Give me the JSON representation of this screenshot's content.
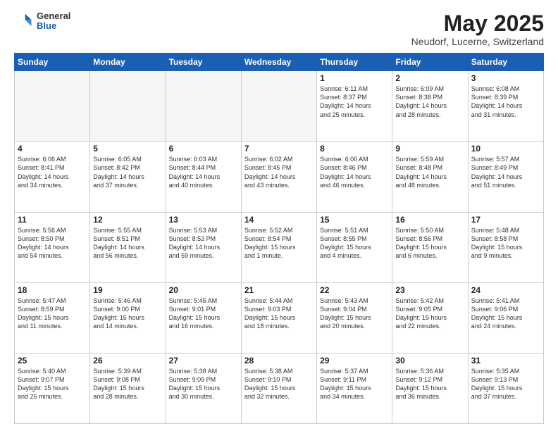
{
  "header": {
    "logo_general": "General",
    "logo_blue": "Blue",
    "month_title": "May 2025",
    "subtitle": "Neudorf, Lucerne, Switzerland"
  },
  "weekdays": [
    "Sunday",
    "Monday",
    "Tuesday",
    "Wednesday",
    "Thursday",
    "Friday",
    "Saturday"
  ],
  "weeks": [
    [
      {
        "day": "",
        "empty": true
      },
      {
        "day": "",
        "empty": true
      },
      {
        "day": "",
        "empty": true
      },
      {
        "day": "",
        "empty": true
      },
      {
        "day": "1",
        "line1": "Sunrise: 6:11 AM",
        "line2": "Sunset: 8:37 PM",
        "line3": "Daylight: 14 hours",
        "line4": "and 25 minutes."
      },
      {
        "day": "2",
        "line1": "Sunrise: 6:09 AM",
        "line2": "Sunset: 8:38 PM",
        "line3": "Daylight: 14 hours",
        "line4": "and 28 minutes."
      },
      {
        "day": "3",
        "line1": "Sunrise: 6:08 AM",
        "line2": "Sunset: 8:39 PM",
        "line3": "Daylight: 14 hours",
        "line4": "and 31 minutes."
      }
    ],
    [
      {
        "day": "4",
        "line1": "Sunrise: 6:06 AM",
        "line2": "Sunset: 8:41 PM",
        "line3": "Daylight: 14 hours",
        "line4": "and 34 minutes."
      },
      {
        "day": "5",
        "line1": "Sunrise: 6:05 AM",
        "line2": "Sunset: 8:42 PM",
        "line3": "Daylight: 14 hours",
        "line4": "and 37 minutes."
      },
      {
        "day": "6",
        "line1": "Sunrise: 6:03 AM",
        "line2": "Sunset: 8:44 PM",
        "line3": "Daylight: 14 hours",
        "line4": "and 40 minutes."
      },
      {
        "day": "7",
        "line1": "Sunrise: 6:02 AM",
        "line2": "Sunset: 8:45 PM",
        "line3": "Daylight: 14 hours",
        "line4": "and 43 minutes."
      },
      {
        "day": "8",
        "line1": "Sunrise: 6:00 AM",
        "line2": "Sunset: 8:46 PM",
        "line3": "Daylight: 14 hours",
        "line4": "and 46 minutes."
      },
      {
        "day": "9",
        "line1": "Sunrise: 5:59 AM",
        "line2": "Sunset: 8:48 PM",
        "line3": "Daylight: 14 hours",
        "line4": "and 48 minutes."
      },
      {
        "day": "10",
        "line1": "Sunrise: 5:57 AM",
        "line2": "Sunset: 8:49 PM",
        "line3": "Daylight: 14 hours",
        "line4": "and 51 minutes."
      }
    ],
    [
      {
        "day": "11",
        "line1": "Sunrise: 5:56 AM",
        "line2": "Sunset: 8:50 PM",
        "line3": "Daylight: 14 hours",
        "line4": "and 54 minutes."
      },
      {
        "day": "12",
        "line1": "Sunrise: 5:55 AM",
        "line2": "Sunset: 8:51 PM",
        "line3": "Daylight: 14 hours",
        "line4": "and 56 minutes."
      },
      {
        "day": "13",
        "line1": "Sunrise: 5:53 AM",
        "line2": "Sunset: 8:53 PM",
        "line3": "Daylight: 14 hours",
        "line4": "and 59 minutes."
      },
      {
        "day": "14",
        "line1": "Sunrise: 5:52 AM",
        "line2": "Sunset: 8:54 PM",
        "line3": "Daylight: 15 hours",
        "line4": "and 1 minute."
      },
      {
        "day": "15",
        "line1": "Sunrise: 5:51 AM",
        "line2": "Sunset: 8:55 PM",
        "line3": "Daylight: 15 hours",
        "line4": "and 4 minutes."
      },
      {
        "day": "16",
        "line1": "Sunrise: 5:50 AM",
        "line2": "Sunset: 8:56 PM",
        "line3": "Daylight: 15 hours",
        "line4": "and 6 minutes."
      },
      {
        "day": "17",
        "line1": "Sunrise: 5:48 AM",
        "line2": "Sunset: 8:58 PM",
        "line3": "Daylight: 15 hours",
        "line4": "and 9 minutes."
      }
    ],
    [
      {
        "day": "18",
        "line1": "Sunrise: 5:47 AM",
        "line2": "Sunset: 8:59 PM",
        "line3": "Daylight: 15 hours",
        "line4": "and 11 minutes."
      },
      {
        "day": "19",
        "line1": "Sunrise: 5:46 AM",
        "line2": "Sunset: 9:00 PM",
        "line3": "Daylight: 15 hours",
        "line4": "and 14 minutes."
      },
      {
        "day": "20",
        "line1": "Sunrise: 5:45 AM",
        "line2": "Sunset: 9:01 PM",
        "line3": "Daylight: 15 hours",
        "line4": "and 16 minutes."
      },
      {
        "day": "21",
        "line1": "Sunrise: 5:44 AM",
        "line2": "Sunset: 9:03 PM",
        "line3": "Daylight: 15 hours",
        "line4": "and 18 minutes."
      },
      {
        "day": "22",
        "line1": "Sunrise: 5:43 AM",
        "line2": "Sunset: 9:04 PM",
        "line3": "Daylight: 15 hours",
        "line4": "and 20 minutes."
      },
      {
        "day": "23",
        "line1": "Sunrise: 5:42 AM",
        "line2": "Sunset: 9:05 PM",
        "line3": "Daylight: 15 hours",
        "line4": "and 22 minutes."
      },
      {
        "day": "24",
        "line1": "Sunrise: 5:41 AM",
        "line2": "Sunset: 9:06 PM",
        "line3": "Daylight: 15 hours",
        "line4": "and 24 minutes."
      }
    ],
    [
      {
        "day": "25",
        "line1": "Sunrise: 5:40 AM",
        "line2": "Sunset: 9:07 PM",
        "line3": "Daylight: 15 hours",
        "line4": "and 26 minutes."
      },
      {
        "day": "26",
        "line1": "Sunrise: 5:39 AM",
        "line2": "Sunset: 9:08 PM",
        "line3": "Daylight: 15 hours",
        "line4": "and 28 minutes."
      },
      {
        "day": "27",
        "line1": "Sunrise: 5:38 AM",
        "line2": "Sunset: 9:09 PM",
        "line3": "Daylight: 15 hours",
        "line4": "and 30 minutes."
      },
      {
        "day": "28",
        "line1": "Sunrise: 5:38 AM",
        "line2": "Sunset: 9:10 PM",
        "line3": "Daylight: 15 hours",
        "line4": "and 32 minutes."
      },
      {
        "day": "29",
        "line1": "Sunrise: 5:37 AM",
        "line2": "Sunset: 9:11 PM",
        "line3": "Daylight: 15 hours",
        "line4": "and 34 minutes."
      },
      {
        "day": "30",
        "line1": "Sunrise: 5:36 AM",
        "line2": "Sunset: 9:12 PM",
        "line3": "Daylight: 15 hours",
        "line4": "and 36 minutes."
      },
      {
        "day": "31",
        "line1": "Sunrise: 5:35 AM",
        "line2": "Sunset: 9:13 PM",
        "line3": "Daylight: 15 hours",
        "line4": "and 37 minutes."
      }
    ]
  ]
}
